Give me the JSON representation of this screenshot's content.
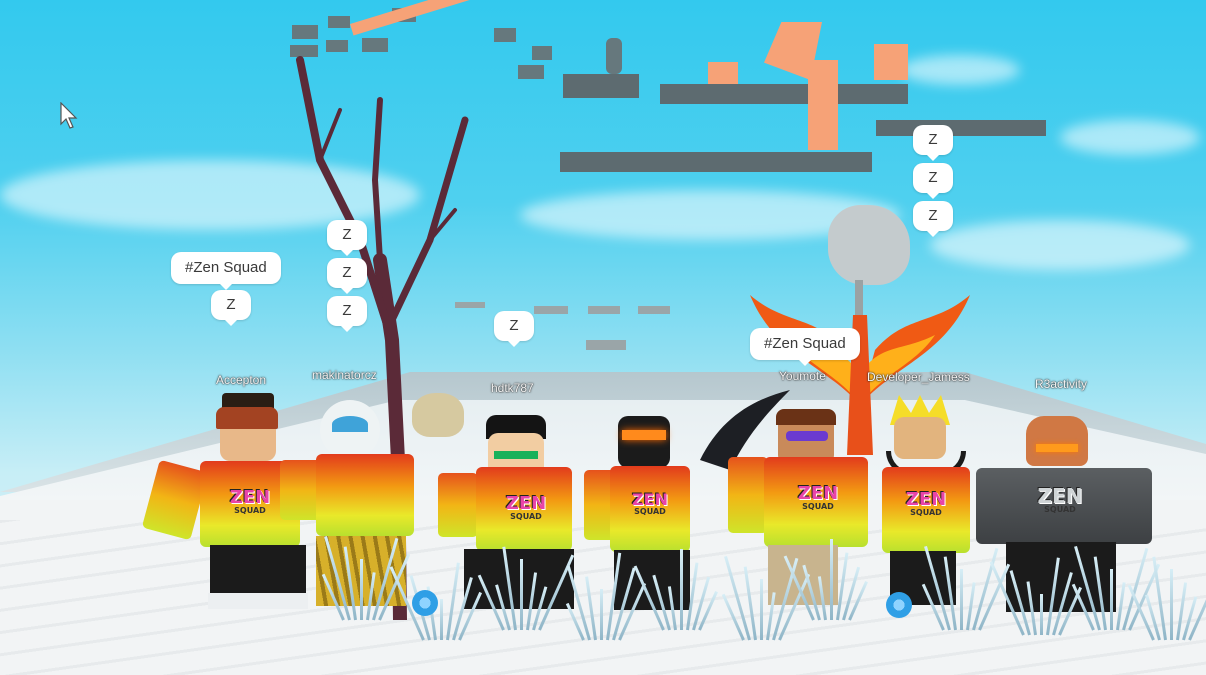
{
  "players": [
    {
      "name": "Accepton",
      "label": "Accepton",
      "bubbles": [
        "#Zen Squad",
        "Z"
      ]
    },
    {
      "name": "makinatorcz",
      "label": "makinatorcz",
      "bubbles": [
        "Z",
        "Z",
        "Z"
      ]
    },
    {
      "name": "hdtk787",
      "label": "hdtk787",
      "bubbles": [
        "Z"
      ]
    },
    {
      "name": "Youmote",
      "label": "Youmote",
      "bubbles": [
        "#Zen Squad"
      ]
    },
    {
      "name": "Developer_Jamess",
      "label": "Developer_Jamess",
      "bubbles": [
        "Z",
        "Z",
        "Z"
      ]
    },
    {
      "name": "R3activity",
      "label": "R3activity",
      "bubbles": []
    }
  ],
  "shirt_logo": {
    "main": "ZEN",
    "sub": "SQUAD"
  },
  "grey_shirt_logo": {
    "main": "ZEN",
    "sub": "SQUAD"
  },
  "colors": {
    "sky": "#33c9ee",
    "ground": "#f2f4f5",
    "bubble": "#ffffff",
    "accent": "#f6a277"
  },
  "icons": [
    "mouse-cursor-icon"
  ]
}
